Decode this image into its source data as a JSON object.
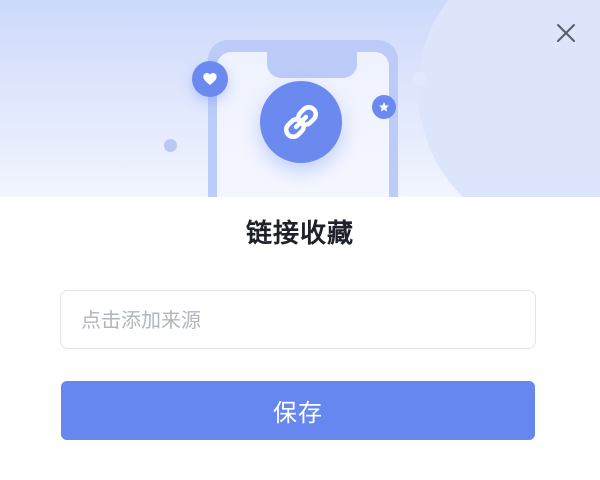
{
  "dialog": {
    "title": "链接收藏",
    "source_input": {
      "value": "",
      "placeholder": "点击添加来源"
    },
    "save_label": "保存"
  },
  "icons": {
    "close": "close-icon",
    "link": "link-icon",
    "heart": "heart-icon",
    "star": "star-icon",
    "phone": "phone-illustration"
  },
  "colors": {
    "accent": "#6687f0",
    "hero_top": "#cdd9fb",
    "title": "#1d2129",
    "placeholder": "#b1b5bd",
    "input_border": "#e2e4e9"
  }
}
